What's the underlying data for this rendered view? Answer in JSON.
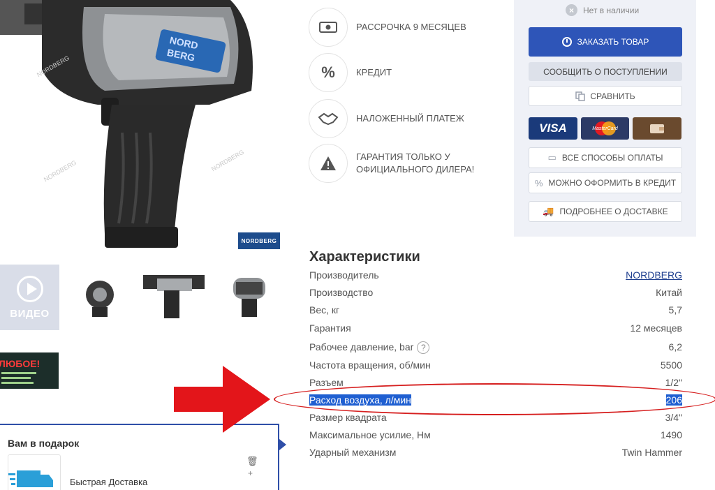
{
  "product": {
    "brand_label": "NORDBERG",
    "watermark": "NORDBERG"
  },
  "gallery": {
    "video_label": "ВИДЕО",
    "promo_title": "ЛЮБОЕ!"
  },
  "features": [
    {
      "text": "РАССРОЧКА 9 МЕСЯЦЕВ",
      "icon": "money-icon"
    },
    {
      "text": "КРЕДИТ",
      "icon": "percent-icon"
    },
    {
      "text": "НАЛОЖЕННЫЙ ПЛАТЕЖ",
      "icon": "handshake-icon"
    },
    {
      "text_line1": "ГАРАНТИЯ ТОЛЬКО У",
      "text_line2": "ОФИЦИАЛЬНОГО ДИЛЕРА!",
      "icon": "warning-icon"
    }
  ],
  "buy_panel": {
    "stock_status": "Нет в наличии",
    "order_button": "ЗАКАЗАТЬ ТОВАР",
    "notify_button": "СООБЩИТЬ О ПОСТУПЛЕНИИ",
    "compare_button": "СРАВНИТЬ",
    "payment_visa": "VISA",
    "payment_mastercard": "MasterCard",
    "all_payment_methods": "ВСЕ СПОСОБЫ ОПЛАТЫ",
    "credit_button": "МОЖНО ОФОРМИТЬ В КРЕДИТ",
    "delivery_button": "ПОДРОБНЕЕ О ДОСТАВКЕ",
    "accent_color": "#2e55b8"
  },
  "specs": {
    "title": "Характеристики",
    "rows": [
      {
        "name": "Производитель",
        "value": "NORDBERG"
      },
      {
        "name": "Производство",
        "value": "Китай"
      },
      {
        "name": "Вес, кг",
        "value": "5,7"
      },
      {
        "name": "Гарантия",
        "value": "12 месяцев"
      },
      {
        "name": "Рабочее давление, bar",
        "value": "6,2"
      },
      {
        "name": "Частота вращения, об/мин",
        "value": "5500"
      },
      {
        "name": "Разъем",
        "value": "1/2\""
      },
      {
        "name": "Расход воздуха, л/мин",
        "value": "206"
      },
      {
        "name": "Размер квадрата",
        "value": "3/4\""
      },
      {
        "name": "Максимальное усилие, Нм",
        "value": "1490"
      },
      {
        "name": "Ударный механизм",
        "value": "Twin Hammer"
      }
    ]
  },
  "gift": {
    "title": "Вам в подарок",
    "item_name": "Быстрая Доставка"
  },
  "annotation": {
    "highlight_color": "#d61f1f"
  }
}
